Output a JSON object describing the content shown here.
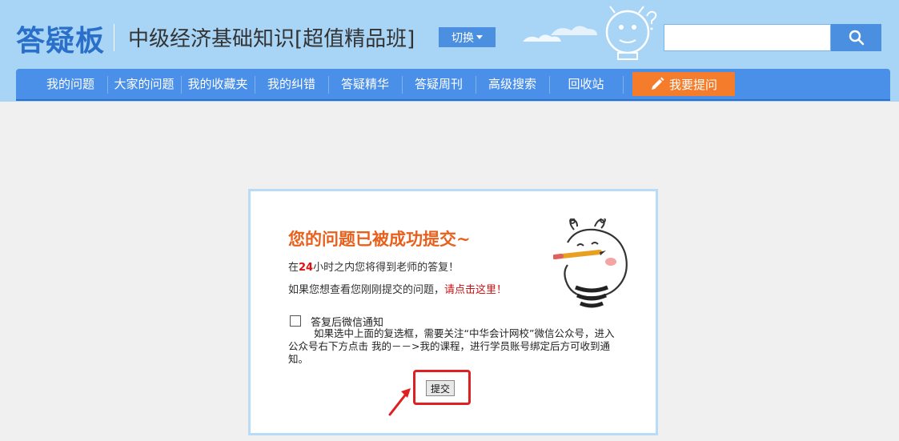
{
  "header": {
    "logo": "答疑板",
    "course_title": "中级经济基础知识[超值精品班]",
    "switch_label": "切换",
    "search": {
      "value": "",
      "placeholder": ""
    }
  },
  "nav": {
    "items": [
      "我的问题",
      "大家的问题",
      "我的收藏夹",
      "我的纠错",
      "答疑精华",
      "答疑周刊",
      "高级搜索",
      "回收站"
    ],
    "ask_label": "我要提问"
  },
  "dialog": {
    "title": "您的问题已被成功提交~",
    "line1_prefix": "在",
    "line1_hours": "24",
    "line1_suffix": "小时之内您将得到老师的答复！",
    "line2_prefix": "如果您想查看您刚刚提交的问题，",
    "line2_link": "请点击这里！",
    "checkbox_label": "答复后微信通知",
    "checkbox_checked": false,
    "notice": "如果选中上面的复选框，需要关注“中华会计网校”微信公众号，进入公众号右下方点击 我的－－>我的课程，进行学员账号绑定后方可收到通知。",
    "submit_label": "提交"
  },
  "colors": {
    "header_bg": "#a8d4f5",
    "nav_bg": "#4a8fe8",
    "ask_button": "#f47c2a",
    "title_orange": "#e8601c",
    "highlight_red": "#e02020"
  },
  "icons": [
    "search-icon",
    "caret-down-icon",
    "pencil-icon",
    "mascot-illustration",
    "cloud-decoration",
    "red-arrow-annotation"
  ]
}
